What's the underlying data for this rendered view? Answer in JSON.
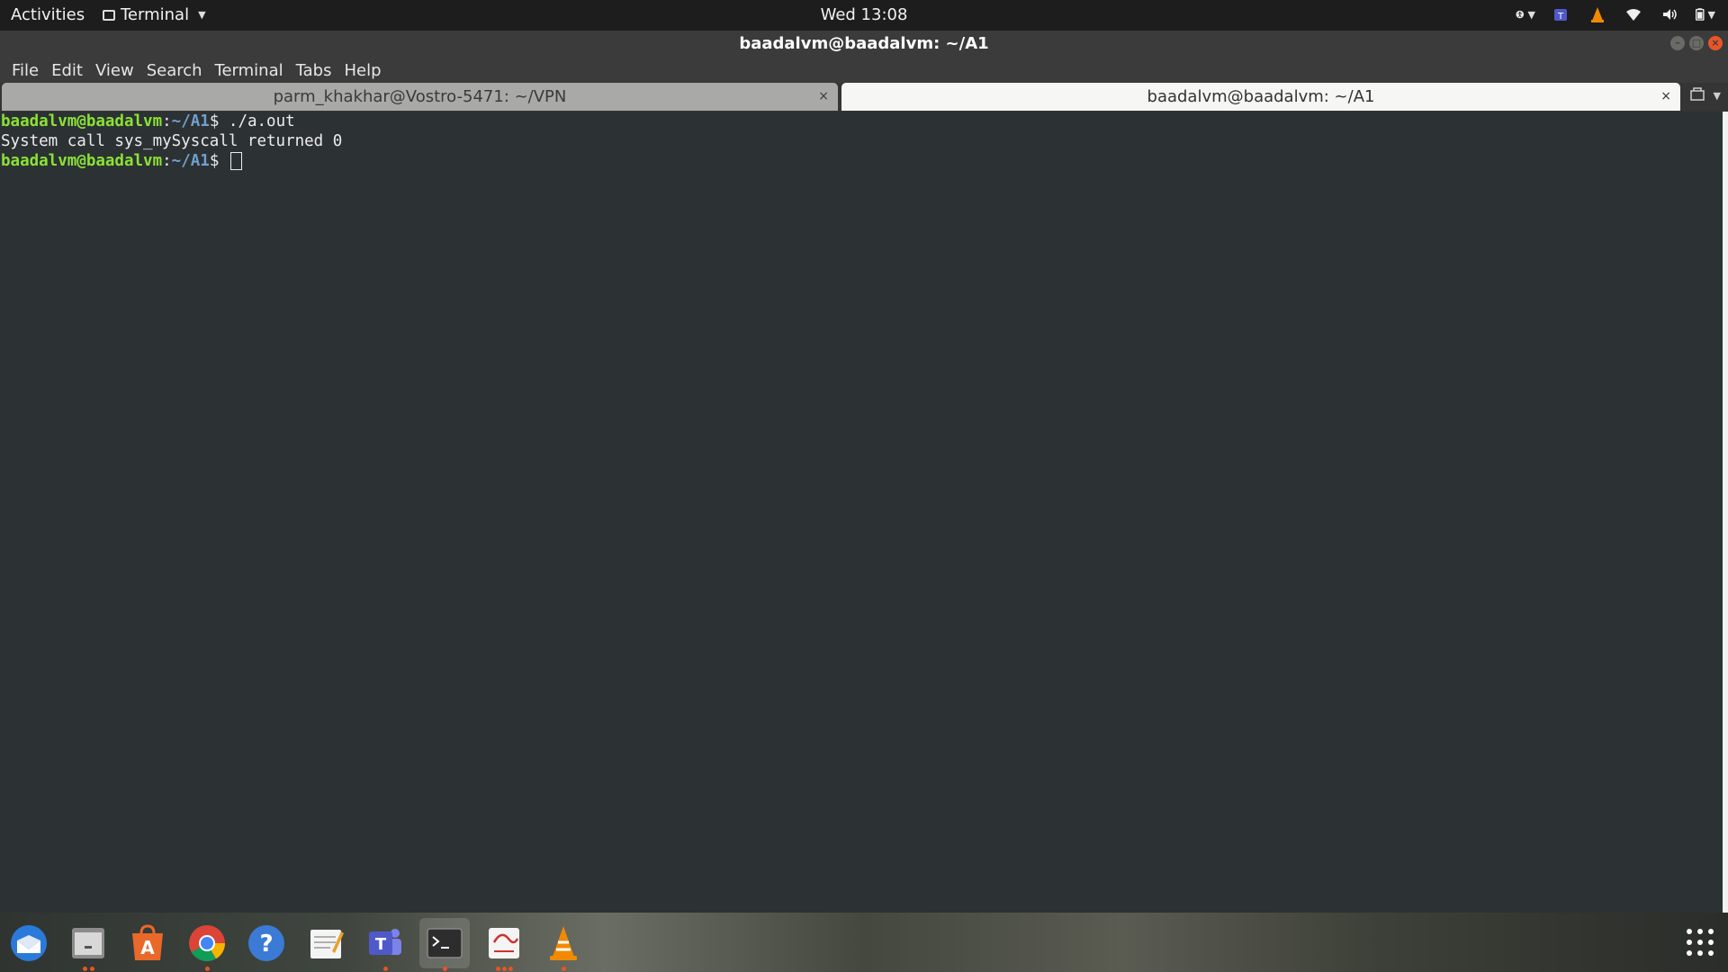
{
  "topbar": {
    "activities": "Activities",
    "app_menu": "Terminal",
    "clock": "Wed 13:08",
    "tray_icons": [
      "accessibility-icon",
      "teams-icon",
      "vlc-icon",
      "wifi-icon",
      "volume-icon",
      "battery-icon"
    ]
  },
  "window": {
    "title": "baadalvm@baadalvm: ~/A1",
    "buttons": [
      "minimize",
      "maximize",
      "close"
    ]
  },
  "menubar": {
    "items": [
      "File",
      "Edit",
      "View",
      "Search",
      "Terminal",
      "Tabs",
      "Help"
    ]
  },
  "tabs": [
    {
      "label": "parm_khakhar@Vostro-5471: ~/VPN",
      "active": false,
      "close": "×"
    },
    {
      "label": "baadalvm@baadalvm: ~/A1",
      "active": true,
      "close": "×"
    }
  ],
  "terminal": {
    "lines": [
      {
        "user": "baadalvm@baadalvm",
        "sep": ":",
        "path": "~/A1",
        "prompt": "$ ",
        "cmd": "./a.out"
      },
      {
        "output": "System call sys_mySyscall returned 0"
      },
      {
        "user": "baadalvm@baadalvm",
        "sep": ":",
        "path": "~/A1",
        "prompt": "$ ",
        "cmd": ""
      }
    ]
  },
  "dock": {
    "apps": [
      "thunderbird-icon",
      "files-icon",
      "software-center-icon",
      "chrome-icon",
      "help-icon",
      "text-editor-icon",
      "teams-icon",
      "terminal-icon",
      "document-viewer-icon",
      "vlc-icon"
    ],
    "show_apps": "apps-grid-icon"
  },
  "colors": {
    "terminal_bg": "#2c3133",
    "prompt_user": "#8ae234",
    "prompt_path": "#729fcf",
    "accent": "#e95420"
  }
}
